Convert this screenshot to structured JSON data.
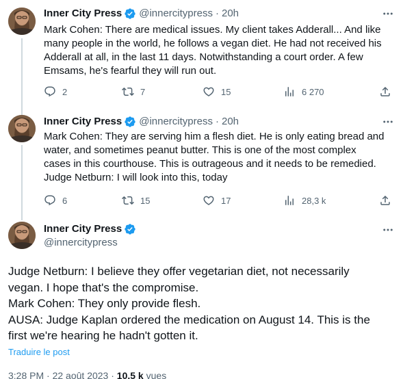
{
  "tweets": [
    {
      "name": "Inner City Press",
      "handle": "@innercitypress",
      "separator": "·",
      "time": "20h",
      "lines": [
        "Mark Cohen: There are medical issues. My client takes Adderall... And like",
        "many people in the world, he follows a vegan diet. He had not received his",
        "Adderall at all, in the last 11 days. Notwithstanding a court order. A few",
        "Emsams, he's fearful they will run out."
      ],
      "replies": "2",
      "reposts": "7",
      "likes": "15",
      "views": "6 270"
    },
    {
      "name": "Inner City Press",
      "handle": "@innercitypress",
      "separator": "·",
      "time": "20h",
      "lines": [
        "Mark Cohen: They are serving him a flesh diet. He is only eating bread and",
        "water, and sometimes peanut butter. This is one of the most complex",
        "cases in this courthouse. This is outrageous and it needs to be remedied.",
        "Judge Netburn: I will look into this, today"
      ],
      "replies": "6",
      "reposts": "15",
      "likes": "17",
      "views": "28,3 k"
    }
  ],
  "main": {
    "name": "Inner City Press",
    "handle": "@innercitypress",
    "lines": [
      "Judge Netburn: I believe they offer vegetarian diet, not necessarily",
      "vegan. I hope that's the compromise.",
      "Mark Cohen: They only provide flesh.",
      "AUSA: Judge Kaplan ordered the medication on August 14. This is the",
      "first we're hearing he hadn't gotten it."
    ],
    "translate_label": "Traduire le post",
    "time": "3:28 PM",
    "date": "22 août 2023",
    "views_count": "10.5 k",
    "views_label": "vues",
    "separator": "·"
  },
  "colors": {
    "text": "#0f1419",
    "secondary": "#536471",
    "accent": "#1d9bf0",
    "thread_line": "#cfd9de"
  },
  "icons": [
    "reply-icon",
    "repost-icon",
    "like-icon",
    "views-icon",
    "share-icon",
    "more-icon",
    "verified-badge-icon"
  ]
}
